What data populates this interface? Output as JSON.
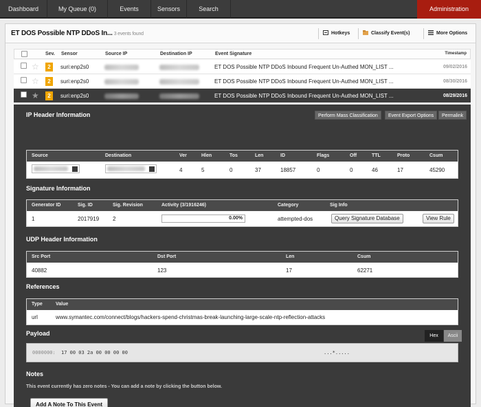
{
  "nav": {
    "tabs": [
      {
        "label": "Dashboard"
      },
      {
        "label": "My Queue (0)"
      },
      {
        "label": "Events"
      },
      {
        "label": "Sensors"
      },
      {
        "label": "Search"
      }
    ],
    "admin_label": "Administration"
  },
  "header": {
    "title": "ET DOS Possible NTP DDoS In...",
    "count": "3 events found",
    "hotkeys": "Hotkeys",
    "classify": "Classify Event(s)",
    "more_options": "More Options"
  },
  "events": {
    "columns": [
      "Sev.",
      "Sensor",
      "Source IP",
      "Destination IP",
      "Event Signature",
      "Timestamp"
    ],
    "rows": [
      {
        "sev": "2",
        "sensor": "suri:enp2s0",
        "signature": "ET DOS Possible NTP DDoS Inbound Frequent Un-Authed MON_LIST ...",
        "timestamp": "09/02/2016",
        "selected": false
      },
      {
        "sev": "2",
        "sensor": "suri:enp2s0",
        "signature": "ET DOS Possible NTP DDoS Inbound Frequent Un-Authed MON_LIST ...",
        "timestamp": "08/30/2016",
        "selected": false
      },
      {
        "sev": "2",
        "sensor": "suri:enp2s0",
        "signature": "ET DOS Possible NTP DDoS Inbound Frequent Un-Authed MON_LIST ...",
        "timestamp": "08/29/2016",
        "selected": true
      }
    ]
  },
  "ip_header": {
    "title": "IP Header Information",
    "buttons": {
      "mass": "Perform Mass Classification",
      "export": "Event Export Options",
      "permalink": "Permalink"
    },
    "columns": [
      "Source",
      "Destination",
      "Ver",
      "Hlen",
      "Tos",
      "Len",
      "ID",
      "Flags",
      "Off",
      "TTL",
      "Proto",
      "Csum"
    ],
    "values": {
      "ver": "4",
      "hlen": "5",
      "tos": "0",
      "len": "37",
      "id": "18857",
      "flags": "0",
      "off": "0",
      "ttl": "46",
      "proto": "17",
      "csum": "45290"
    }
  },
  "signature": {
    "title": "Signature Information",
    "columns": [
      "Generator ID",
      "Sig. ID",
      "Sig. Revision",
      "Activity (3/1916246)",
      "Category",
      "Sig Info"
    ],
    "values": {
      "gen_id": "1",
      "sig_id": "2017919",
      "revision": "2",
      "activity": "0.00%",
      "activity_fraction": 0.0,
      "category": "attempted-dos"
    },
    "query_button": "Query Signature Database",
    "rule_button": "View Rule"
  },
  "udp": {
    "title": "UDP Header Information",
    "columns": [
      "Src Port",
      "Dst Port",
      "Len",
      "Csum"
    ],
    "values": {
      "src_port": "40882",
      "dst_port": "123",
      "len": "17",
      "csum": "62271"
    }
  },
  "references": {
    "title": "References",
    "columns": [
      "Type",
      "Value"
    ],
    "type": "url",
    "value": "www.symantec.com/connect/blogs/hackers-spend-christmas-break-launching-large-scale-ntp-reflection-attacks"
  },
  "payload": {
    "title": "Payload",
    "hex_label": "Hex",
    "ascii_label": "Ascii",
    "offset": "0000000:",
    "hex": "17 00 03 2a 00 00 00 00",
    "ascii": "...*....."
  },
  "notes": {
    "title": "Notes",
    "text": "This event currently has zero notes - You can add a note by clicking the button below.",
    "add_button": "Add A Note To This Event"
  },
  "colors": {
    "admin": "#a81d10",
    "severity": "#f0a500",
    "detail_bg": "#3a3a3a"
  }
}
